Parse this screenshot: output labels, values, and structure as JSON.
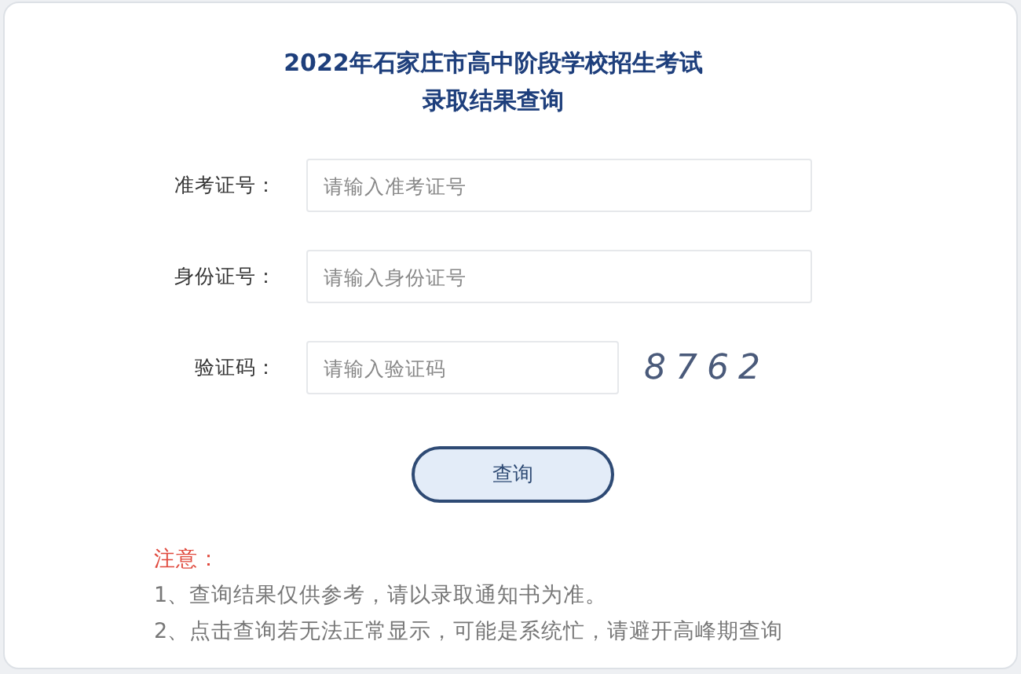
{
  "title": [
    "2022年石家庄市高中阶段学校招生考试",
    "录取结果查询"
  ],
  "fields": [
    {
      "label": "准考证号：",
      "placeholder": "请输入准考证号",
      "kind": "text"
    },
    {
      "label": "身份证号：",
      "placeholder": "请输入身份证号",
      "kind": "text"
    },
    {
      "label": "验证码：",
      "placeholder": "请输入验证码",
      "kind": "captcha",
      "captcha": "8762"
    }
  ],
  "button": "查询",
  "notice": {
    "heading": "注意：",
    "items": [
      "1、查询结果仅供参考，请以录取通知书为准。",
      "2、点击查询若无法正常显示，可能是系统忙，请避开高峰期查询"
    ]
  }
}
